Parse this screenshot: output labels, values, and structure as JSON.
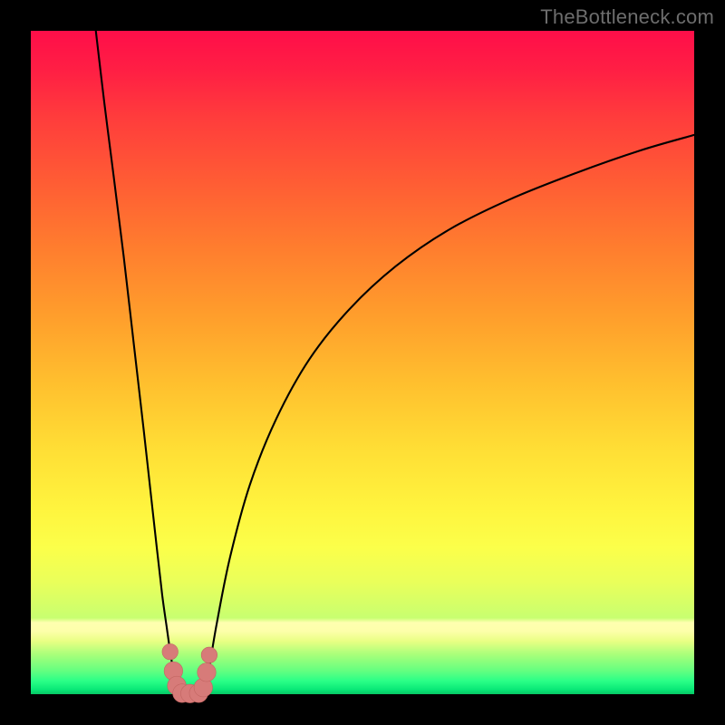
{
  "watermark": "TheBottleneck.com",
  "colors": {
    "frame": "#000000",
    "curve": "#000000",
    "marker_fill": "#d77b79",
    "marker_stroke": "#c26561"
  },
  "chart_data": {
    "type": "line",
    "title": "",
    "xlabel": "",
    "ylabel": "",
    "xlim": [
      0,
      100
    ],
    "ylim": [
      0,
      100
    ],
    "series": [
      {
        "name": "left-branch",
        "x": [
          9.8,
          11.1,
          12.5,
          14.0,
          15.5,
          17.0,
          18.0,
          19.0,
          19.8,
          20.5,
          21.0,
          21.5,
          22.3
        ],
        "y": [
          100,
          89,
          78,
          66,
          53,
          40,
          31,
          22,
          15,
          10,
          6.5,
          3.5,
          0.15
        ]
      },
      {
        "name": "valley-floor",
        "x": [
          22.3,
          22.8,
          23.4,
          24.0,
          24.7,
          25.4,
          26.0
        ],
        "y": [
          0.15,
          0.1,
          0.08,
          0.08,
          0.1,
          0.14,
          0.2
        ]
      },
      {
        "name": "right-branch",
        "x": [
          26.0,
          26.8,
          28.0,
          30.0,
          33.0,
          37.0,
          42.0,
          48.0,
          55.0,
          63.0,
          72.0,
          82.0,
          92.0,
          100.0
        ],
        "y": [
          0.2,
          3.5,
          10.5,
          20.5,
          31.5,
          41.5,
          50.5,
          58.0,
          64.5,
          70.0,
          74.5,
          78.5,
          82.0,
          84.3
        ]
      }
    ],
    "markers": [
      {
        "x": 21.0,
        "y": 6.4,
        "r": 1.2
      },
      {
        "x": 21.5,
        "y": 3.5,
        "r": 1.4
      },
      {
        "x": 22.0,
        "y": 1.3,
        "r": 1.4
      },
      {
        "x": 22.8,
        "y": 0.15,
        "r": 1.4
      },
      {
        "x": 24.0,
        "y": 0.1,
        "r": 1.4
      },
      {
        "x": 25.3,
        "y": 0.15,
        "r": 1.4
      },
      {
        "x": 26.0,
        "y": 1.0,
        "r": 1.4
      },
      {
        "x": 26.5,
        "y": 3.3,
        "r": 1.4
      },
      {
        "x": 26.9,
        "y": 5.9,
        "r": 1.2
      }
    ]
  }
}
